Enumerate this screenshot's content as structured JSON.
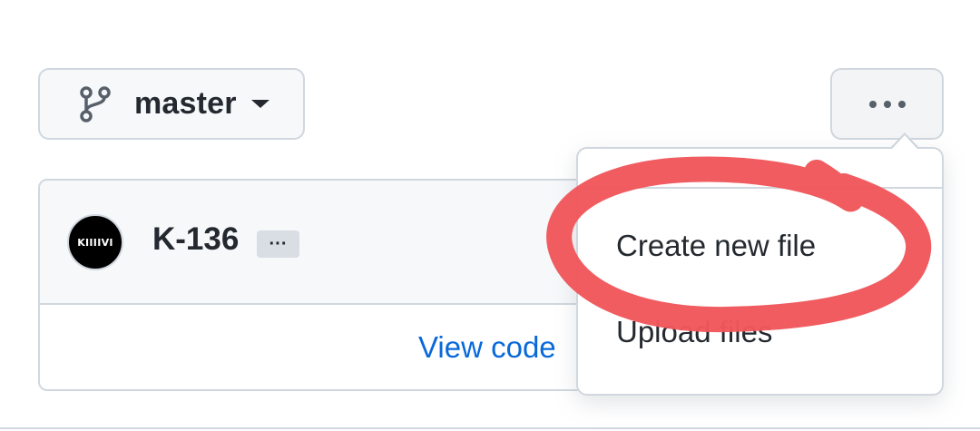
{
  "branch": {
    "label": "master",
    "icon": "git-branch-icon"
  },
  "more_button": {
    "icon": "kebab-horizontal-icon"
  },
  "commit": {
    "avatar_text": "KIIIIVI",
    "author": "K-136",
    "ellipsis": "···",
    "view_code": "View code"
  },
  "menu": {
    "items": [
      {
        "label": "Create new file"
      },
      {
        "label": "Upload files"
      }
    ]
  },
  "annotation": {
    "color": "#f0575b",
    "target": "Create new file"
  },
  "colors": {
    "border": "#d0d7de",
    "link": "#0969da",
    "text": "#24292f",
    "header_bg": "#f6f8fa"
  }
}
